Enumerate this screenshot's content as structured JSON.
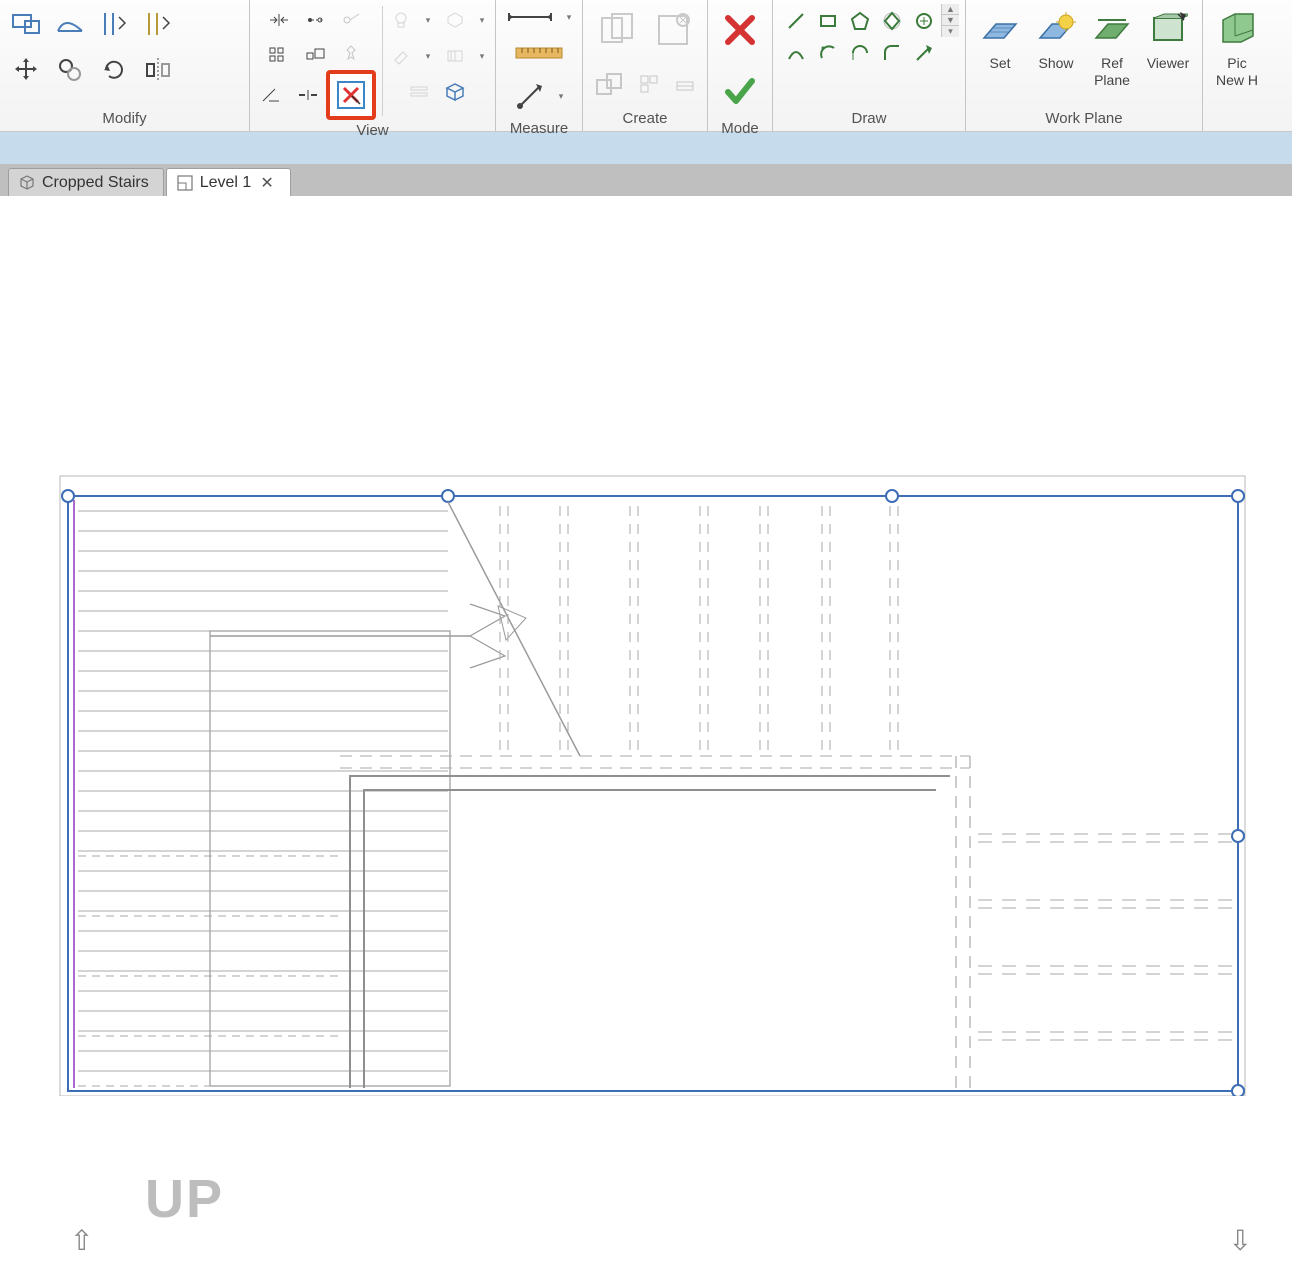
{
  "ribbon": {
    "panels": {
      "modify": {
        "title": "Modify"
      },
      "view": {
        "title": "View"
      },
      "measure": {
        "title": "Measure"
      },
      "create": {
        "title": "Create"
      },
      "mode": {
        "title": "Mode"
      },
      "draw": {
        "title": "Draw"
      },
      "workplane": {
        "title": "Work Plane",
        "set": "Set",
        "show": "Show",
        "refplane_line1": "Ref",
        "refplane_line2": "Plane",
        "viewer": "Viewer"
      },
      "next": {
        "pic": "Pic",
        "newh": "New H"
      }
    }
  },
  "tabs": {
    "project": "Cropped Stairs",
    "active": "Level 1"
  },
  "canvas": {
    "direction_label": "UP"
  }
}
